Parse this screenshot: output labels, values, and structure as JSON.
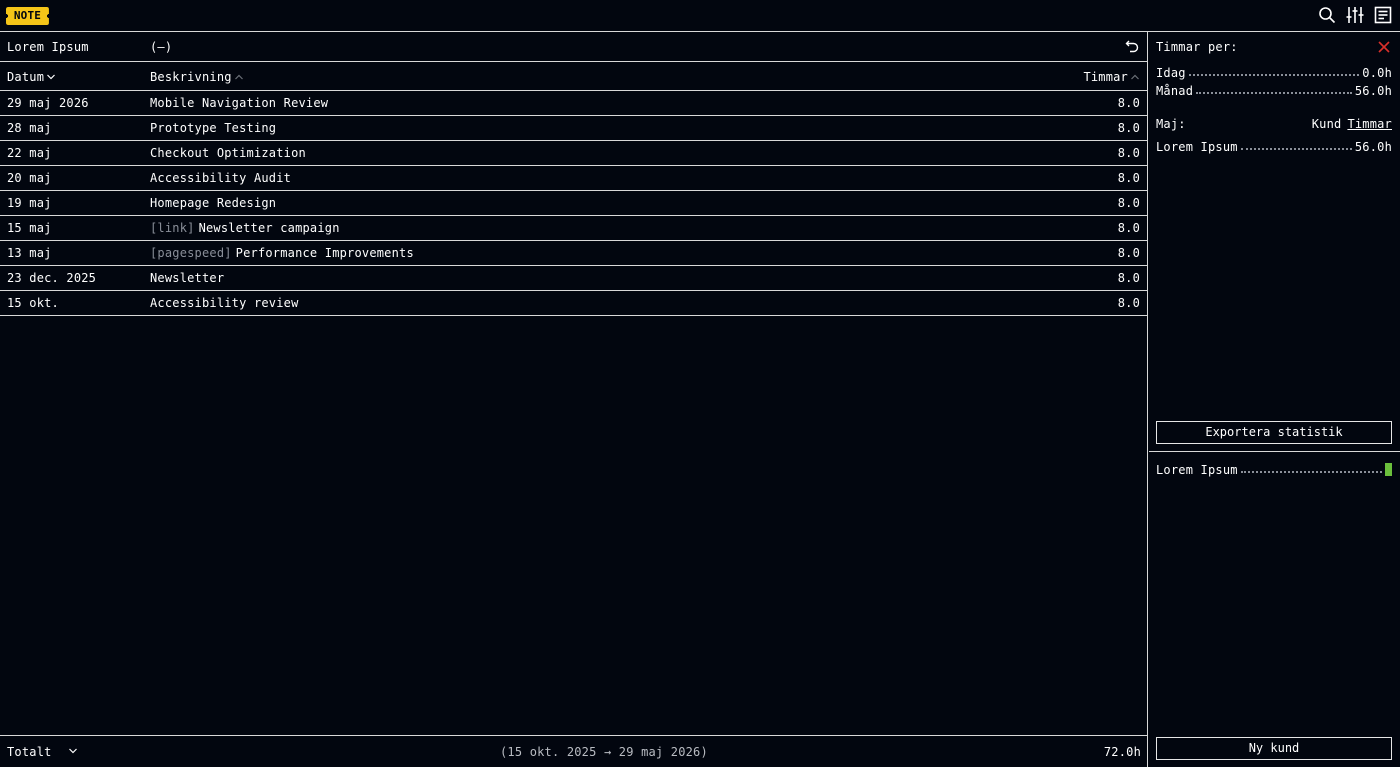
{
  "app": {
    "logo_text": "NOTE",
    "logo_color": "#f5c518",
    "icons": [
      "search-icon",
      "sliders-icon",
      "notes-icon"
    ]
  },
  "main": {
    "client_name": "Lorem Ipsum",
    "client_count": "(—)",
    "columns": {
      "date": "Datum",
      "description": "Beskrivning",
      "hours": "Timmar"
    },
    "rows": [
      {
        "date": "29 maj 2026",
        "tag": "",
        "description": "Mobile Navigation Review",
        "hours": "8.0"
      },
      {
        "date": "28 maj",
        "tag": "",
        "description": "Prototype Testing",
        "hours": "8.0"
      },
      {
        "date": "22 maj",
        "tag": "",
        "description": "Checkout Optimization",
        "hours": "8.0"
      },
      {
        "date": "20 maj",
        "tag": "",
        "description": "Accessibility Audit",
        "hours": "8.0"
      },
      {
        "date": "19 maj",
        "tag": "",
        "description": "Homepage Redesign",
        "hours": "8.0"
      },
      {
        "date": "15 maj",
        "tag": "[link]",
        "description": "Newsletter campaign",
        "hours": "8.0"
      },
      {
        "date": "13 maj",
        "tag": "[pagespeed]",
        "description": "Performance Improvements",
        "hours": "8.0"
      },
      {
        "date": "23 dec. 2025",
        "tag": "",
        "description": "Newsletter",
        "hours": "8.0"
      },
      {
        "date": "15 okt.",
        "tag": "",
        "description": "Accessibility review",
        "hours": "8.0"
      }
    ],
    "footer": {
      "total_label": "Totalt",
      "range": "(15 okt. 2025 → 29 maj 2026)",
      "total_value": "72.0h"
    }
  },
  "stats": {
    "title": "Timmar per:",
    "today_label": "Idag",
    "today_value": "0.0h",
    "month_label": "Månad",
    "month_value": "56.0h",
    "period_label": "Maj:",
    "sort_client": "Kund",
    "sort_hours": "Timmar",
    "client_row_label": "Lorem Ipsum",
    "client_row_value": "56.0h",
    "export_button": "Exportera statistik",
    "close_color": "#d9302b"
  },
  "clients": {
    "entry_label": "Lorem Ipsum",
    "entry_color": "#6bbf3c",
    "new_button": "Ny kund"
  }
}
